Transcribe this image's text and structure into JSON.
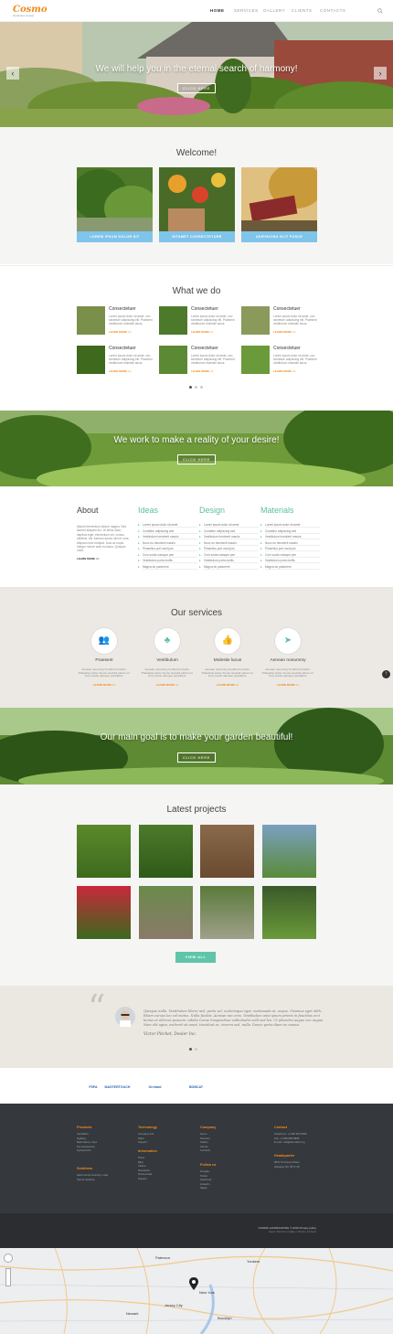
{
  "header": {
    "logo": "Cosmo",
    "tagline": "landscape design",
    "nav": [
      "HOME",
      "SERVICES",
      "GALLERY",
      "CLIENTS",
      "CONTACTS"
    ]
  },
  "hero": {
    "title": "We will help you in the eternal search of harmony!",
    "button": "CLICK HERE"
  },
  "welcome": {
    "title": "Welcome!",
    "buttons": [
      "LOREM IPSUM DOLOR SIT",
      "SITAMET CONSECTETUER",
      "ADIPISCING ELIT FUSCE"
    ]
  },
  "what_we_do": {
    "title": "What we do",
    "items": [
      {
        "title": "Consectetuer",
        "text": "Lorem ipsum dolor sit amet, con sectetuer adipiscing elit. Praesent vestibulum molestie lacus.",
        "more": "LEARN MORE >>"
      },
      {
        "title": "Consectetuer",
        "text": "Lorem ipsum dolor sit amet, con sectetuer adipiscing elit. Praesent vestibulum molestie lacus.",
        "more": "LEARN MORE >>"
      },
      {
        "title": "Consectetuer",
        "text": "Lorem ipsum dolor sit amet, con sectetuer adipiscing elit. Praesent vestibulum molestie lacus.",
        "more": "LEARN MORE >>"
      },
      {
        "title": "Consectetuer",
        "text": "Lorem ipsum dolor sit amet, con sectetuer adipiscing elit. Praesent vestibulum molestie lacus.",
        "more": "LEARN MORE >>"
      },
      {
        "title": "Consectetuer",
        "text": "Lorem ipsum dolor sit amet, con sectetuer adipiscing elit. Praesent vestibulum molestie lacus.",
        "more": "LEARN MORE >>"
      },
      {
        "title": "Consectetuer",
        "text": "Lorem ipsum dolor sit amet, con sectetuer adipiscing elit. Praesent vestibulum molestie lacus.",
        "more": "LEARN MORE >>"
      }
    ]
  },
  "banner1": {
    "title": "We work to make a reality of your desire!",
    "button": "CLICK HERE"
  },
  "about": {
    "title": "About",
    "text": "Mauris fermentum dictum magna. Sed laoreet aliquam leo. Ut tellus dolor, dapibus eget, elementum vel, cursus eleifend, elit. Aenean auctor wisi et urna. Aliquam erat volutpat. Duis ac turpis. Integer rutrum ante eu lacus. Quisque nulla.",
    "more": "LEARN MORE >>"
  },
  "columns": [
    {
      "title": "Ideas",
      "color": "#5fbe9f",
      "items": [
        "Lorem ipsum dolor sit amet",
        "Curabitur adipiscing sed",
        "Vestibulum hendrerit mauris",
        "Nunc eu hendrerit mauris",
        "Phasellus port oscit just",
        "Cum sociis natoque pen",
        "Vestibulum porta mollis",
        "Magna do parturient"
      ]
    },
    {
      "title": "Design",
      "color": "#5fbe9f",
      "items": [
        "Lorem ipsum dolor sit amet",
        "Curabitur adipiscing sed",
        "Vestibulum hendrerit mauris",
        "Nunc eu hendrerit mauris",
        "Phasellus port oscit just",
        "Cum sociis natoque pen",
        "Vestibulum porta mollis",
        "Magna do parturient"
      ]
    },
    {
      "title": "Materials",
      "color": "#5fbe9f",
      "items": [
        "Lorem ipsum dolor sit amet",
        "Curabitur adipiscing sed",
        "Vestibulum hendrerit mauris",
        "Nunc eu hendrerit mauris",
        "Phasellus port oscit just",
        "Cum sociis natoque pen",
        "Vestibulum porta mollis",
        "Magna do parturient"
      ]
    }
  ],
  "services": {
    "title": "Our services",
    "items": [
      {
        "title": "Praesent",
        "icon": "people-icon",
        "text": "Aenean nonummy hendrerit mauris. Phasellus porta. Fusce suscipit varius mi. Cum sociis natoque penatibus.",
        "more": "LEARN MORE >>"
      },
      {
        "title": "Vestibulum",
        "icon": "tree-icon",
        "text": "Aenean nonummy hendrerit mauris. Phasellus porta. Fusce suscipit varius mi. Cum sociis natoque penatibus.",
        "more": "LEARN MORE >>"
      },
      {
        "title": "Molestie lacus",
        "icon": "thumbs-up-icon",
        "text": "Aenean nonummy hendrerit mauris. Phasellus porta. Fusce suscipit varius mi. Cum sociis natoque penatibus.",
        "more": "LEARN MORE >>"
      },
      {
        "title": "Aenean nonummy",
        "icon": "paper-plane-icon",
        "text": "Aenean nonummy hendrerit mauris. Phasellus porta. Fusce suscipit varius mi. Cum sociis natoque penatibus.",
        "more": "LEARN MORE >>"
      }
    ]
  },
  "banner2": {
    "title": "Our main goal is to make your garden beautiful!",
    "button": "CLICK HERE"
  },
  "projects": {
    "title": "Latest projects",
    "button": "VIEW ALL"
  },
  "testimonial": {
    "text": "Quisque nulla. Vestibulum libero nisl, porta vel, scelerisque eget, malesuada at, neque. Vivamus eget nibh. Etiam cursus leo vel metus. Nulla facilisi. Aenean nec eros. Vestibulum ante ipsum primis in faucibus orci luctus et ultrices posuere cubilia Curae Suspendisse sollicitudin velit sed leo. Ut pharetra augue nec augue. Nam elit agna, endrerit sit amet, tincidunt ac, viverra sed, nulla. Donec porta diam eu massa.",
    "author": "Victor Pitchet, Dealer Inc."
  },
  "partners": [
    "FSPA",
    "MASTERTOUCH",
    "",
    "Orchard",
    "",
    "BOBCAT",
    "",
    "",
    "",
    "",
    ""
  ],
  "footer": {
    "products": {
      "title": "Products",
      "items": [
        "Ventilation",
        "Lighting",
        "Beds &amp; trays",
        "Pot accessories",
        "Hydroponics"
      ]
    },
    "solutions": {
      "title": "Solutions",
      "items": [
        "Hand scenic sourcing, solar",
        "Sports cleaning"
      ]
    },
    "technology": {
      "title": "Technology",
      "items": [
        "Company info",
        "Parts",
        "Support"
      ]
    },
    "information": {
      "title": "Information",
      "items": [
        "Press",
        "Blog",
        "Videos",
        "Newsletter",
        "Testimonials",
        "Support"
      ]
    },
    "company": {
      "title": "Company",
      "items": [
        "Home",
        "Services",
        "Gallery",
        "Clients",
        "Contacts"
      ]
    },
    "follow": {
      "title": "Follow us",
      "items": [
        "Google+",
        "Twitter",
        "Facebook",
        "LinkedIn",
        "Skype"
      ]
    },
    "contact": {
      "title": "Contact",
      "items": [
        "Telephone: +1 800 603 6035",
        "Fax: +1 800 889 9898",
        "E-mail: mail@demolink.org"
      ]
    },
    "headquarter": {
      "title": "Headquarter",
      "items": [
        "9870 St Vincent Place,",
        "Glasgow, DC 45 Fr 45."
      ]
    },
    "copyright": "COSMO LANDSCAPING © 2015 Privacy policy",
    "sub": "Home | Services | Gallery | Clients | Contacts"
  },
  "map": {
    "labels": [
      "New York",
      "Newark",
      "Paterson",
      "Yonkers",
      "Brooklyn",
      "Jersey City"
    ]
  }
}
